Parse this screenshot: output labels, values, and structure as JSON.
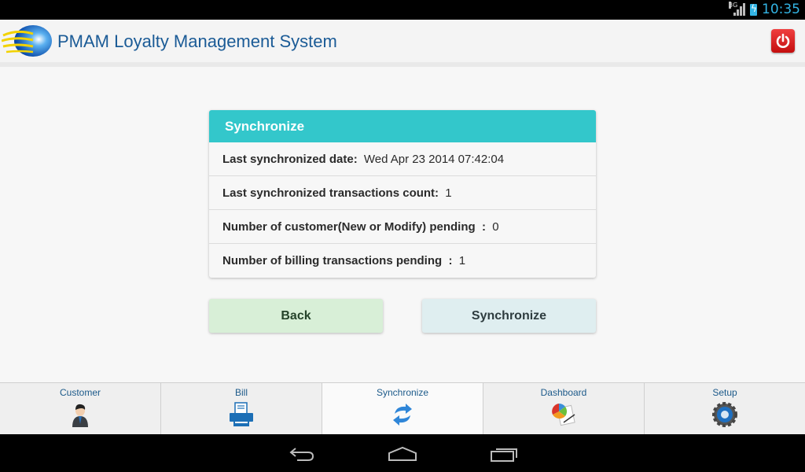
{
  "status_bar": {
    "network": "3G",
    "time": "10:35"
  },
  "app_bar": {
    "title": "PMAM Loyalty Management System",
    "icons": {
      "logo": "globe-logo-icon",
      "power": "power-icon"
    }
  },
  "sync_card": {
    "title": "Synchronize",
    "rows": [
      {
        "label": "Last synchronized date:",
        "value": "Wed Apr 23 2014 07:42:04"
      },
      {
        "label": "Last synchronized transactions count:",
        "value": "1"
      },
      {
        "label": "Number of customer(New or Modify) pending  :",
        "value": "0"
      },
      {
        "label": "Number of billing transactions pending  :",
        "value": "1"
      }
    ]
  },
  "buttons": {
    "back": "Back",
    "synchronize": "Synchronize"
  },
  "tabs": [
    {
      "label": "Customer",
      "icon": "customer-icon",
      "active": false
    },
    {
      "label": "Bill",
      "icon": "printer-icon",
      "active": false
    },
    {
      "label": "Synchronize",
      "icon": "sync-icon",
      "active": true
    },
    {
      "label": "Dashboard",
      "icon": "dashboard-chart-icon",
      "active": false
    },
    {
      "label": "Setup",
      "icon": "gear-icon",
      "active": false
    }
  ],
  "nav_bar": {
    "icons": [
      "back-icon",
      "home-icon",
      "recent-apps-icon"
    ]
  }
}
